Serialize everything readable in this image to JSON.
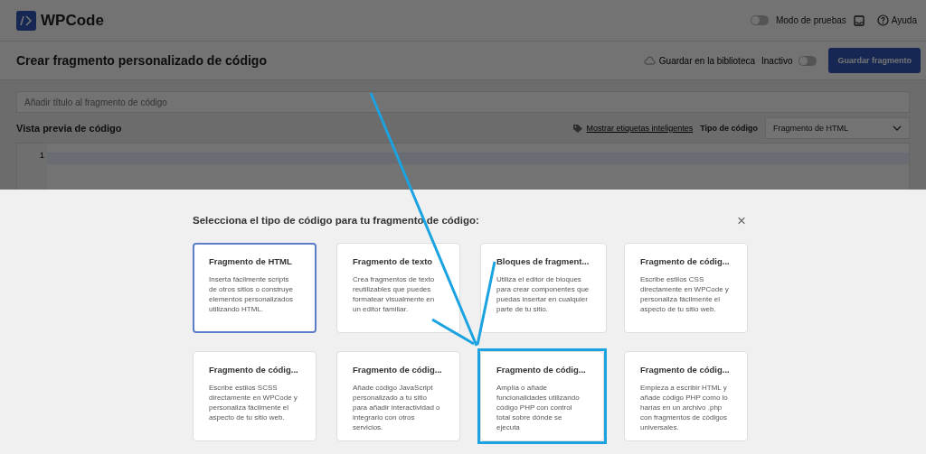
{
  "header": {
    "logo": "WPCode",
    "test_mode": {
      "label": "Modo de pruebas",
      "on": false
    },
    "help": "Ayuda"
  },
  "title_bar": {
    "title": "Crear fragmento personalizado de código",
    "save_library": "Guardar en la biblioteca",
    "status": {
      "label": "Inactivo",
      "on": false
    },
    "save_button": "Guardar fragmento"
  },
  "editor": {
    "title_placeholder": "Añadir título al fragmento de código",
    "preview_title": "Vista previa de código",
    "smart_tags_link": "Mostrar etiquetas inteligentes",
    "code_type_label": "Tipo de código",
    "code_type_value": "Fragmento de HTML",
    "line_numbers": [
      "1"
    ]
  },
  "modal": {
    "title": "Selecciona el tipo de código para tu fragmento de código:",
    "close": "×",
    "cards": [
      {
        "title": "Fragmento de HTML",
        "description": "Inserta fácilmente scripts de otros sitios o construye elementos personalizados utilizando HTML.",
        "selected": true,
        "highlighted": false
      },
      {
        "title": "Fragmento de texto",
        "description": "Crea fragmentos de texto reutilizables que puedes formatear visualmente en un editor familiar.",
        "selected": false,
        "highlighted": false
      },
      {
        "title": "Bloques de fragment...",
        "description": "Utiliza el editor de bloques para crear componentes que puedas insertar en cualquier parte de tu sitio.",
        "selected": false,
        "highlighted": false
      },
      {
        "title": "Fragmento de códig...",
        "description": "Escribe estilos CSS directamente en WPCode y personaliza fácilmente el aspecto de tu sitio web.",
        "selected": false,
        "highlighted": false
      },
      {
        "title": "Fragmento de códig...",
        "description": "Escribe estilos SCSS directamente en WPCode y personaliza fácilmente el aspecto de tu sitio web.",
        "selected": false,
        "highlighted": false
      },
      {
        "title": "Fragmento de códig...",
        "description": "Añade código JavaScript personalizado a tu sitio para añadir interactividad o integrarlo con otros servicios.",
        "selected": false,
        "highlighted": false
      },
      {
        "title": "Fragmento de códig...",
        "description": "Amplía o añade funcionalidades utilizando código PHP con control total sobre dónde se ejecuta",
        "selected": false,
        "highlighted": true
      },
      {
        "title": "Fragmento de códig...",
        "description": "Empieza a escribir HTML y añade código PHP como lo harías en un archivo .php con fragmentos de códigos universales.",
        "selected": false,
        "highlighted": false
      }
    ]
  }
}
